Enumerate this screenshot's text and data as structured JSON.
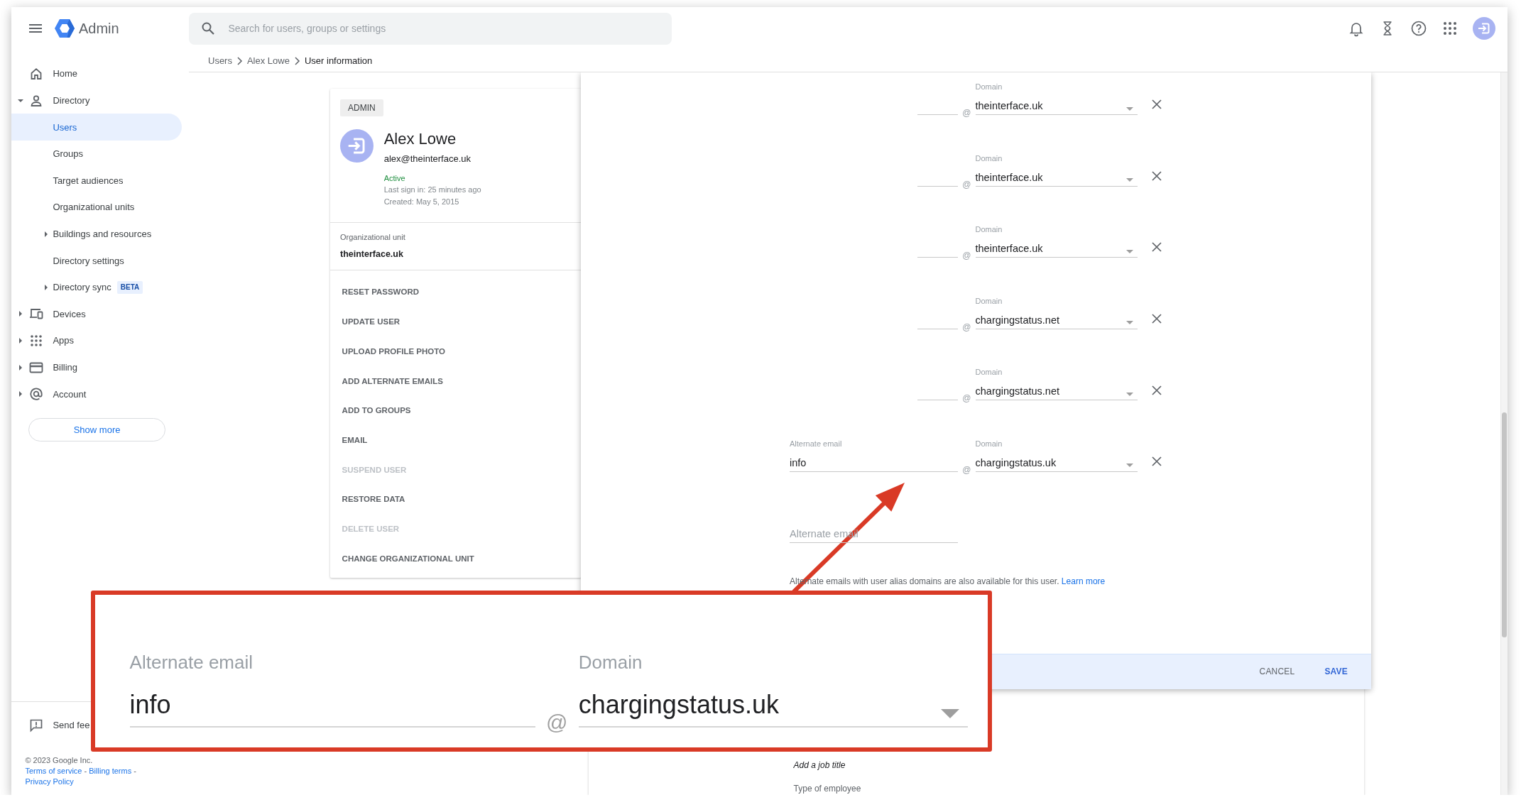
{
  "header": {
    "app_name": "Admin",
    "search": {
      "placeholder": "Search for users, groups or settings"
    }
  },
  "breadcrumb": [
    {
      "label": "Users"
    },
    {
      "label": "Alex Lowe"
    },
    {
      "label": "User information"
    }
  ],
  "sidebar": {
    "items": [
      {
        "label": "Home",
        "selected": false
      },
      {
        "label": "Directory",
        "selected": false,
        "expanded": true,
        "children": [
          {
            "label": "Users",
            "selected": true
          },
          {
            "label": "Groups",
            "selected": false
          },
          {
            "label": "Target audiences",
            "selected": false
          },
          {
            "label": "Organizational units",
            "selected": false
          },
          {
            "label": "Buildings and resources",
            "selected": false,
            "expanded": false
          },
          {
            "label": "Directory settings",
            "selected": false
          },
          {
            "label": "Directory sync",
            "selected": false,
            "expanded": false,
            "badge": "BETA"
          }
        ]
      },
      {
        "label": "Devices",
        "selected": false,
        "expanded": false
      },
      {
        "label": "Apps",
        "selected": false,
        "expanded": false
      },
      {
        "label": "Billing",
        "selected": false,
        "expanded": false
      },
      {
        "label": "Account",
        "selected": false,
        "expanded": false
      }
    ],
    "show_more": "Show more",
    "feedback": "Send fee",
    "copyright": "© 2023 Google Inc.",
    "links": [
      {
        "label": "Terms of service",
        "separator": "-"
      },
      {
        "label": "Billing terms",
        "separator": "-"
      },
      {
        "label": "Privacy Policy"
      }
    ]
  },
  "user_card": {
    "role_badge": "ADMIN",
    "name": "Alex Lowe",
    "email": "alex@theinterface.uk",
    "status": "Active",
    "last_sign_in": "Last sign in: 25 minutes ago",
    "created": "Created: May 5, 2015",
    "org_unit_label": "Organizational unit",
    "org_unit": "theinterface.uk",
    "actions": [
      {
        "label": "RESET PASSWORD",
        "disabled": false
      },
      {
        "label": "UPDATE USER",
        "disabled": false
      },
      {
        "label": "UPLOAD PROFILE PHOTO",
        "disabled": false
      },
      {
        "label": "ADD ALTERNATE EMAILS",
        "disabled": false
      },
      {
        "label": "ADD TO GROUPS",
        "disabled": false
      },
      {
        "label": "EMAIL",
        "disabled": false
      },
      {
        "label": "SUSPEND USER",
        "disabled": true
      },
      {
        "label": "RESTORE DATA",
        "disabled": false
      },
      {
        "label": "DELETE USER",
        "disabled": true
      },
      {
        "label": "CHANGE ORGANIZATIONAL UNIT",
        "disabled": false
      }
    ]
  },
  "alias_dialog": {
    "rows": [
      {
        "at": "@",
        "domain_label": "Domain",
        "domain": "theinterface.uk"
      },
      {
        "at": "@",
        "domain_label": "Domain",
        "domain": "theinterface.uk"
      },
      {
        "at": "@",
        "domain_label": "Domain",
        "domain": "theinterface.uk"
      },
      {
        "at": "@",
        "domain_label": "Domain",
        "domain": "chargingstatus.net"
      },
      {
        "at": "@",
        "domain_label": "Domain",
        "domain": "chargingstatus.net"
      },
      {
        "local_label": "Alternate email",
        "local_value": "info",
        "at": "@",
        "domain_label": "Domain",
        "domain": "chargingstatus.uk"
      }
    ],
    "new_email": {
      "placeholder": "Alternate email"
    },
    "help_text": "Alternate emails with user alias domains are also available for this user.",
    "help_link": "Learn more",
    "buttons": [
      {
        "label": "CANCEL",
        "kind": "secondary"
      },
      {
        "label": "SAVE",
        "kind": "primary"
      }
    ]
  },
  "details_card": {
    "job_title_hint": "Add a job title",
    "employee_type_label": "Type of employee"
  },
  "callout": {
    "local_label": "Alternate email",
    "local_value": "info",
    "at": "@",
    "domain_label": "Domain",
    "domain": "chargingstatus.uk"
  }
}
